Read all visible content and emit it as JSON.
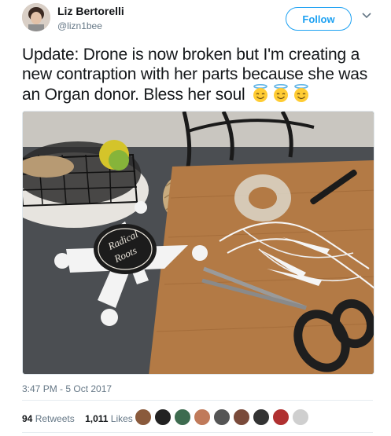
{
  "author": {
    "display_name": "Liz Bertorelli",
    "handle": "@lizn1bee"
  },
  "follow_label": "Follow",
  "tweet": {
    "text": "Update: Drone is now broken but I'm creating a new contraption with her parts because she was an Organ donor. Bless her soul",
    "emoji": [
      "smiling-face-with-halo",
      "smiling-face-with-halo",
      "smiling-face-with-halo"
    ]
  },
  "photo": {
    "drone_logo_line1": "Radical",
    "drone_logo_line2": "Roots"
  },
  "timestamp": "3:47 PM - 5 Oct 2017",
  "stats": {
    "retweets_count": "94",
    "retweets_label": "Retweets",
    "likes_count": "1,011",
    "likes_label": "Likes"
  },
  "liker_colors": [
    "#8a5a3c",
    "#222222",
    "#3d6b4f",
    "#c07a5a",
    "#555555",
    "#7a4a3a",
    "#333333",
    "#b03030",
    "#cfcfcf"
  ],
  "colors": {
    "accent": "#1da1f2",
    "secondary_text": "#657786"
  }
}
